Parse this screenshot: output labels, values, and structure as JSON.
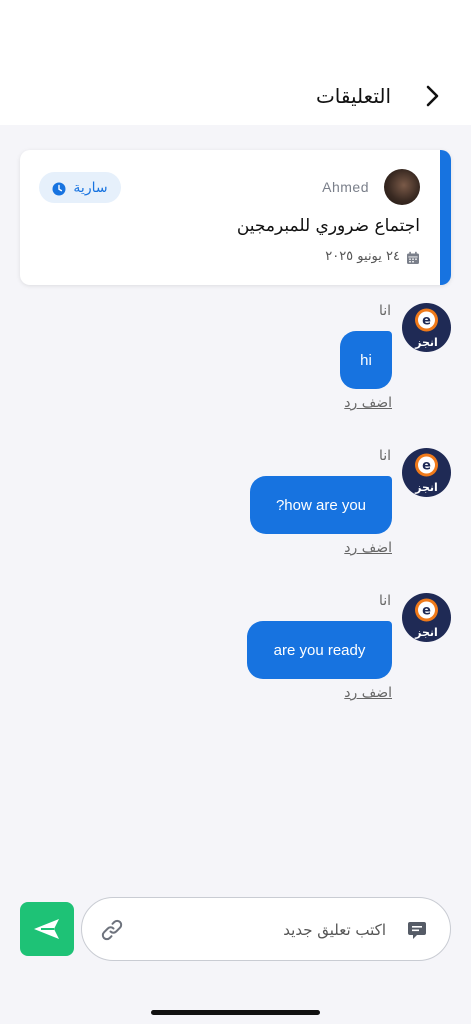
{
  "header": {
    "title": "التعليقات"
  },
  "event_card": {
    "author": "Ahmed",
    "status_badge": "سارية",
    "title": "اجتماع ضروري للمبرمجين",
    "date": "٢٤ يونيو ٢٠٢٥"
  },
  "messages": [
    {
      "sender": "انا",
      "text": "hi",
      "reply_label": "اضف رد",
      "avatar_label": "انجز"
    },
    {
      "sender": "انا",
      "text": "?how are you",
      "reply_label": "اضف رد",
      "avatar_label": "انجز"
    },
    {
      "sender": "انا",
      "text": "are you ready",
      "reply_label": "اضف رد",
      "avatar_label": "انجز"
    }
  ],
  "composer": {
    "placeholder": "اكتب تعليق جديد"
  },
  "colors": {
    "accent": "#1773e0",
    "send_button": "#1ec276",
    "badge_bg": "#e6f0fb",
    "avatar_bg": "#1f2a55",
    "logo_orange": "#f07a1a"
  }
}
